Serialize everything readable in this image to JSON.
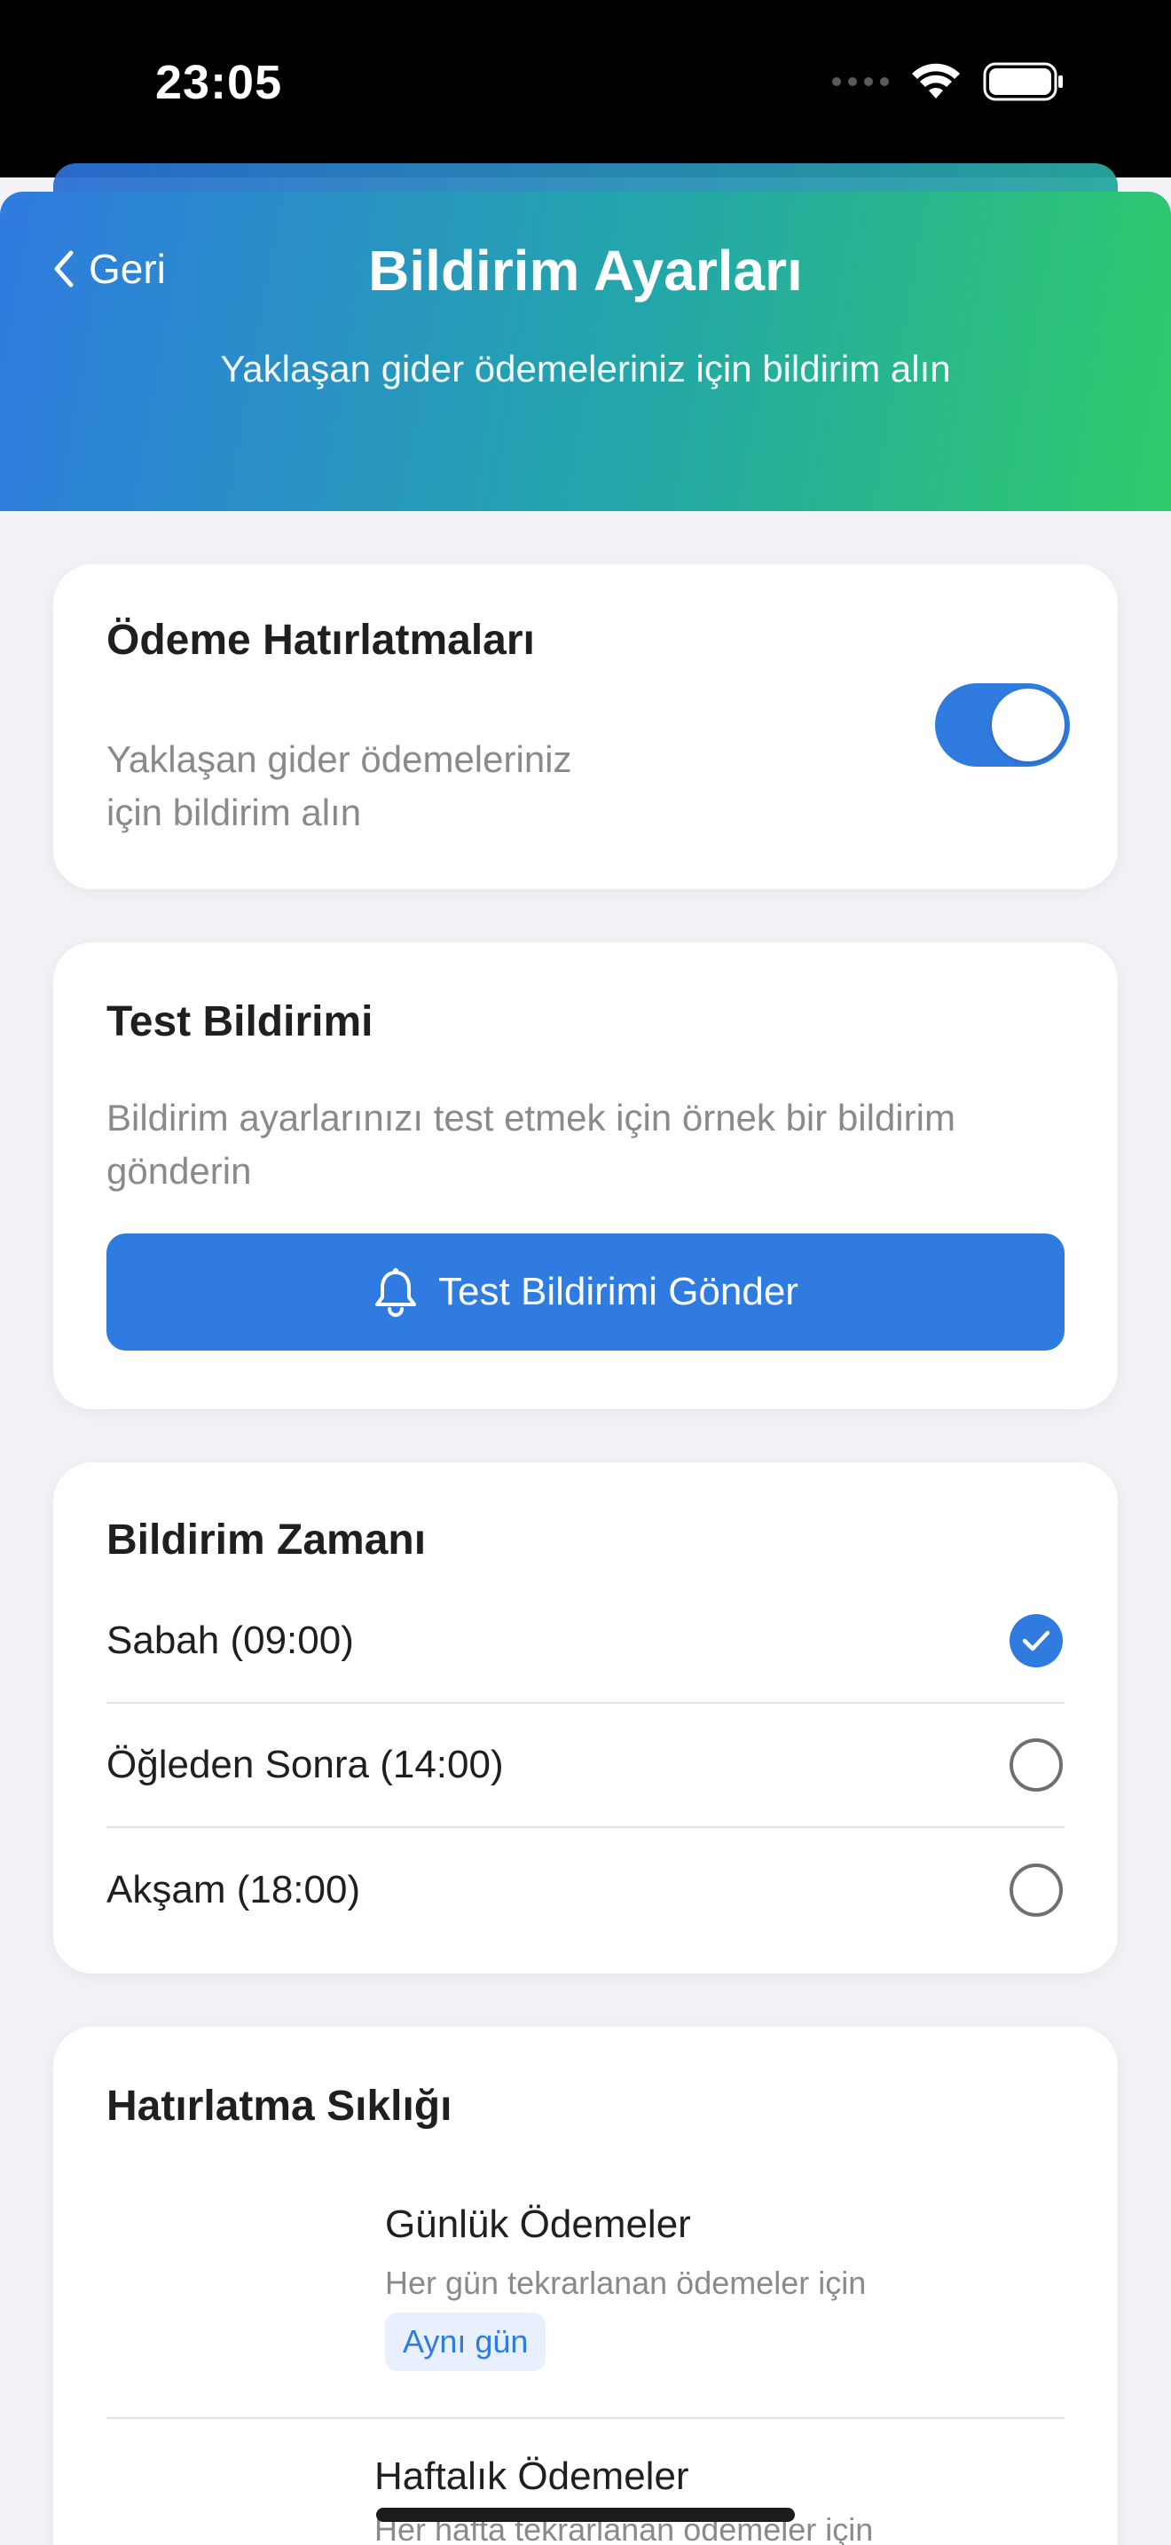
{
  "status_bar": {
    "time": "23:05"
  },
  "header": {
    "back_label": "Geri",
    "title": "Bildirim Ayarları",
    "subtitle": "Yaklaşan gider ödemeleriniz için bildirim alın"
  },
  "reminders_card": {
    "title": "Ödeme Hatırlatmaları",
    "description": "Yaklaşan gider ödemeleriniz için bildirim alın",
    "toggle_on": true
  },
  "test_card": {
    "title": "Test Bildirimi",
    "description": "Bildirim ayarlarınızı test etmek için örnek bir bildirim gönderin",
    "button_label": "Test Bildirimi Gönder"
  },
  "time_card": {
    "title": "Bildirim Zamanı",
    "options": [
      {
        "label": "Sabah (09:00)",
        "selected": true
      },
      {
        "label": "Öğleden Sonra (14:00)",
        "selected": false
      },
      {
        "label": "Akşam (18:00)",
        "selected": false
      }
    ]
  },
  "frequency_card": {
    "title": "Hatırlatma Sıklığı",
    "items": [
      {
        "title": "Günlük Ödemeler",
        "description": "Her gün tekrarlanan ödemeler için",
        "badge": "Aynı gün"
      },
      {
        "title": "Haftalık Ödemeler",
        "description": "Her hafta tekrarlanan ödemeler için"
      }
    ]
  },
  "colors": {
    "accent": "#2f7be0",
    "gradient_start": "#2f7be0",
    "gradient_mid": "#23a7a9",
    "gradient_end": "#2fca6a"
  },
  "icons": {
    "back": "chevron-left-icon",
    "test_button": "bell-icon",
    "checked": "checkmark-icon"
  }
}
